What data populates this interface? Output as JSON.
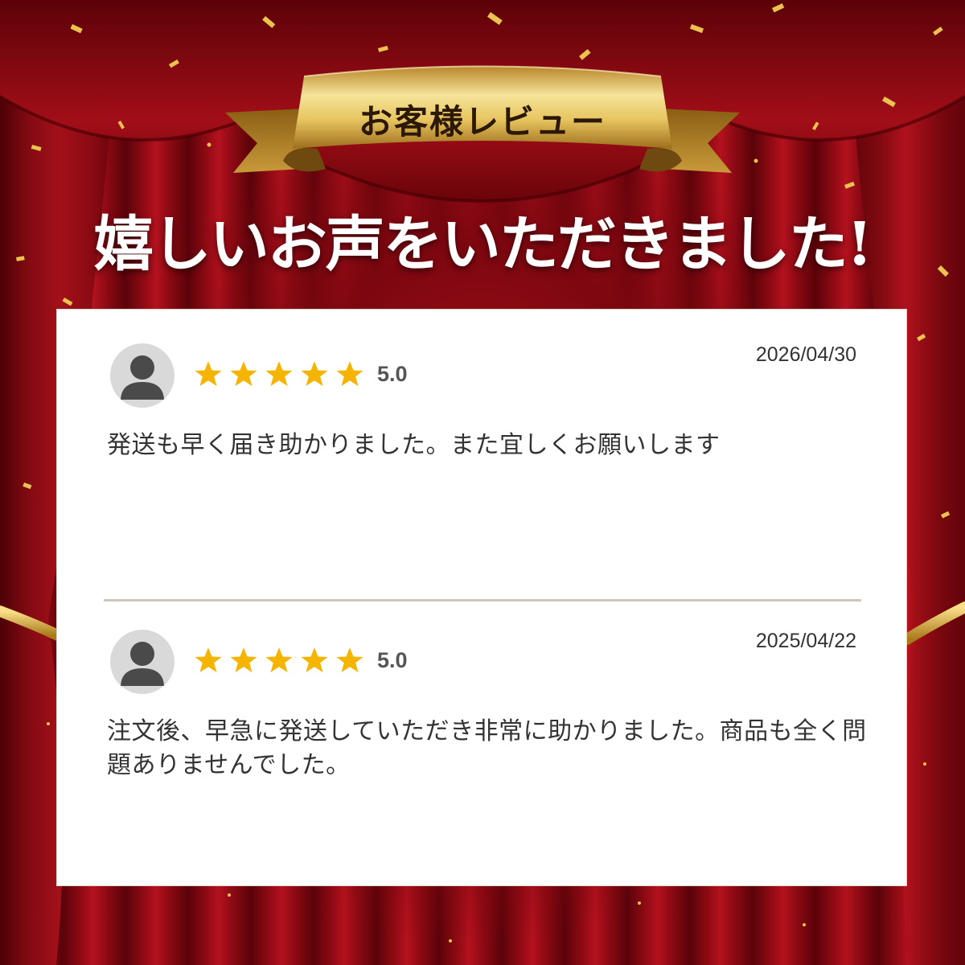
{
  "banner": {
    "label": "お客様レビュー"
  },
  "headline": "嬉しいお声をいただきました!",
  "reviews": [
    {
      "rating": "5.0",
      "stars": 5,
      "date": "2026/04/30",
      "text": "発送も早く届き助かりました。また宜しくお願いします"
    },
    {
      "rating": "5.0",
      "stars": 5,
      "date": "2025/04/22",
      "text": "注文後、早急に発送していただき非常に助かりました。商品も全く問題ありませんでした。"
    }
  ],
  "colors": {
    "curtain": "#8e0a14",
    "gold": "#d8b24a",
    "star": "#f5b400",
    "card": "#ffffff"
  },
  "icons": [
    "user-avatar-icon",
    "star-icon"
  ]
}
